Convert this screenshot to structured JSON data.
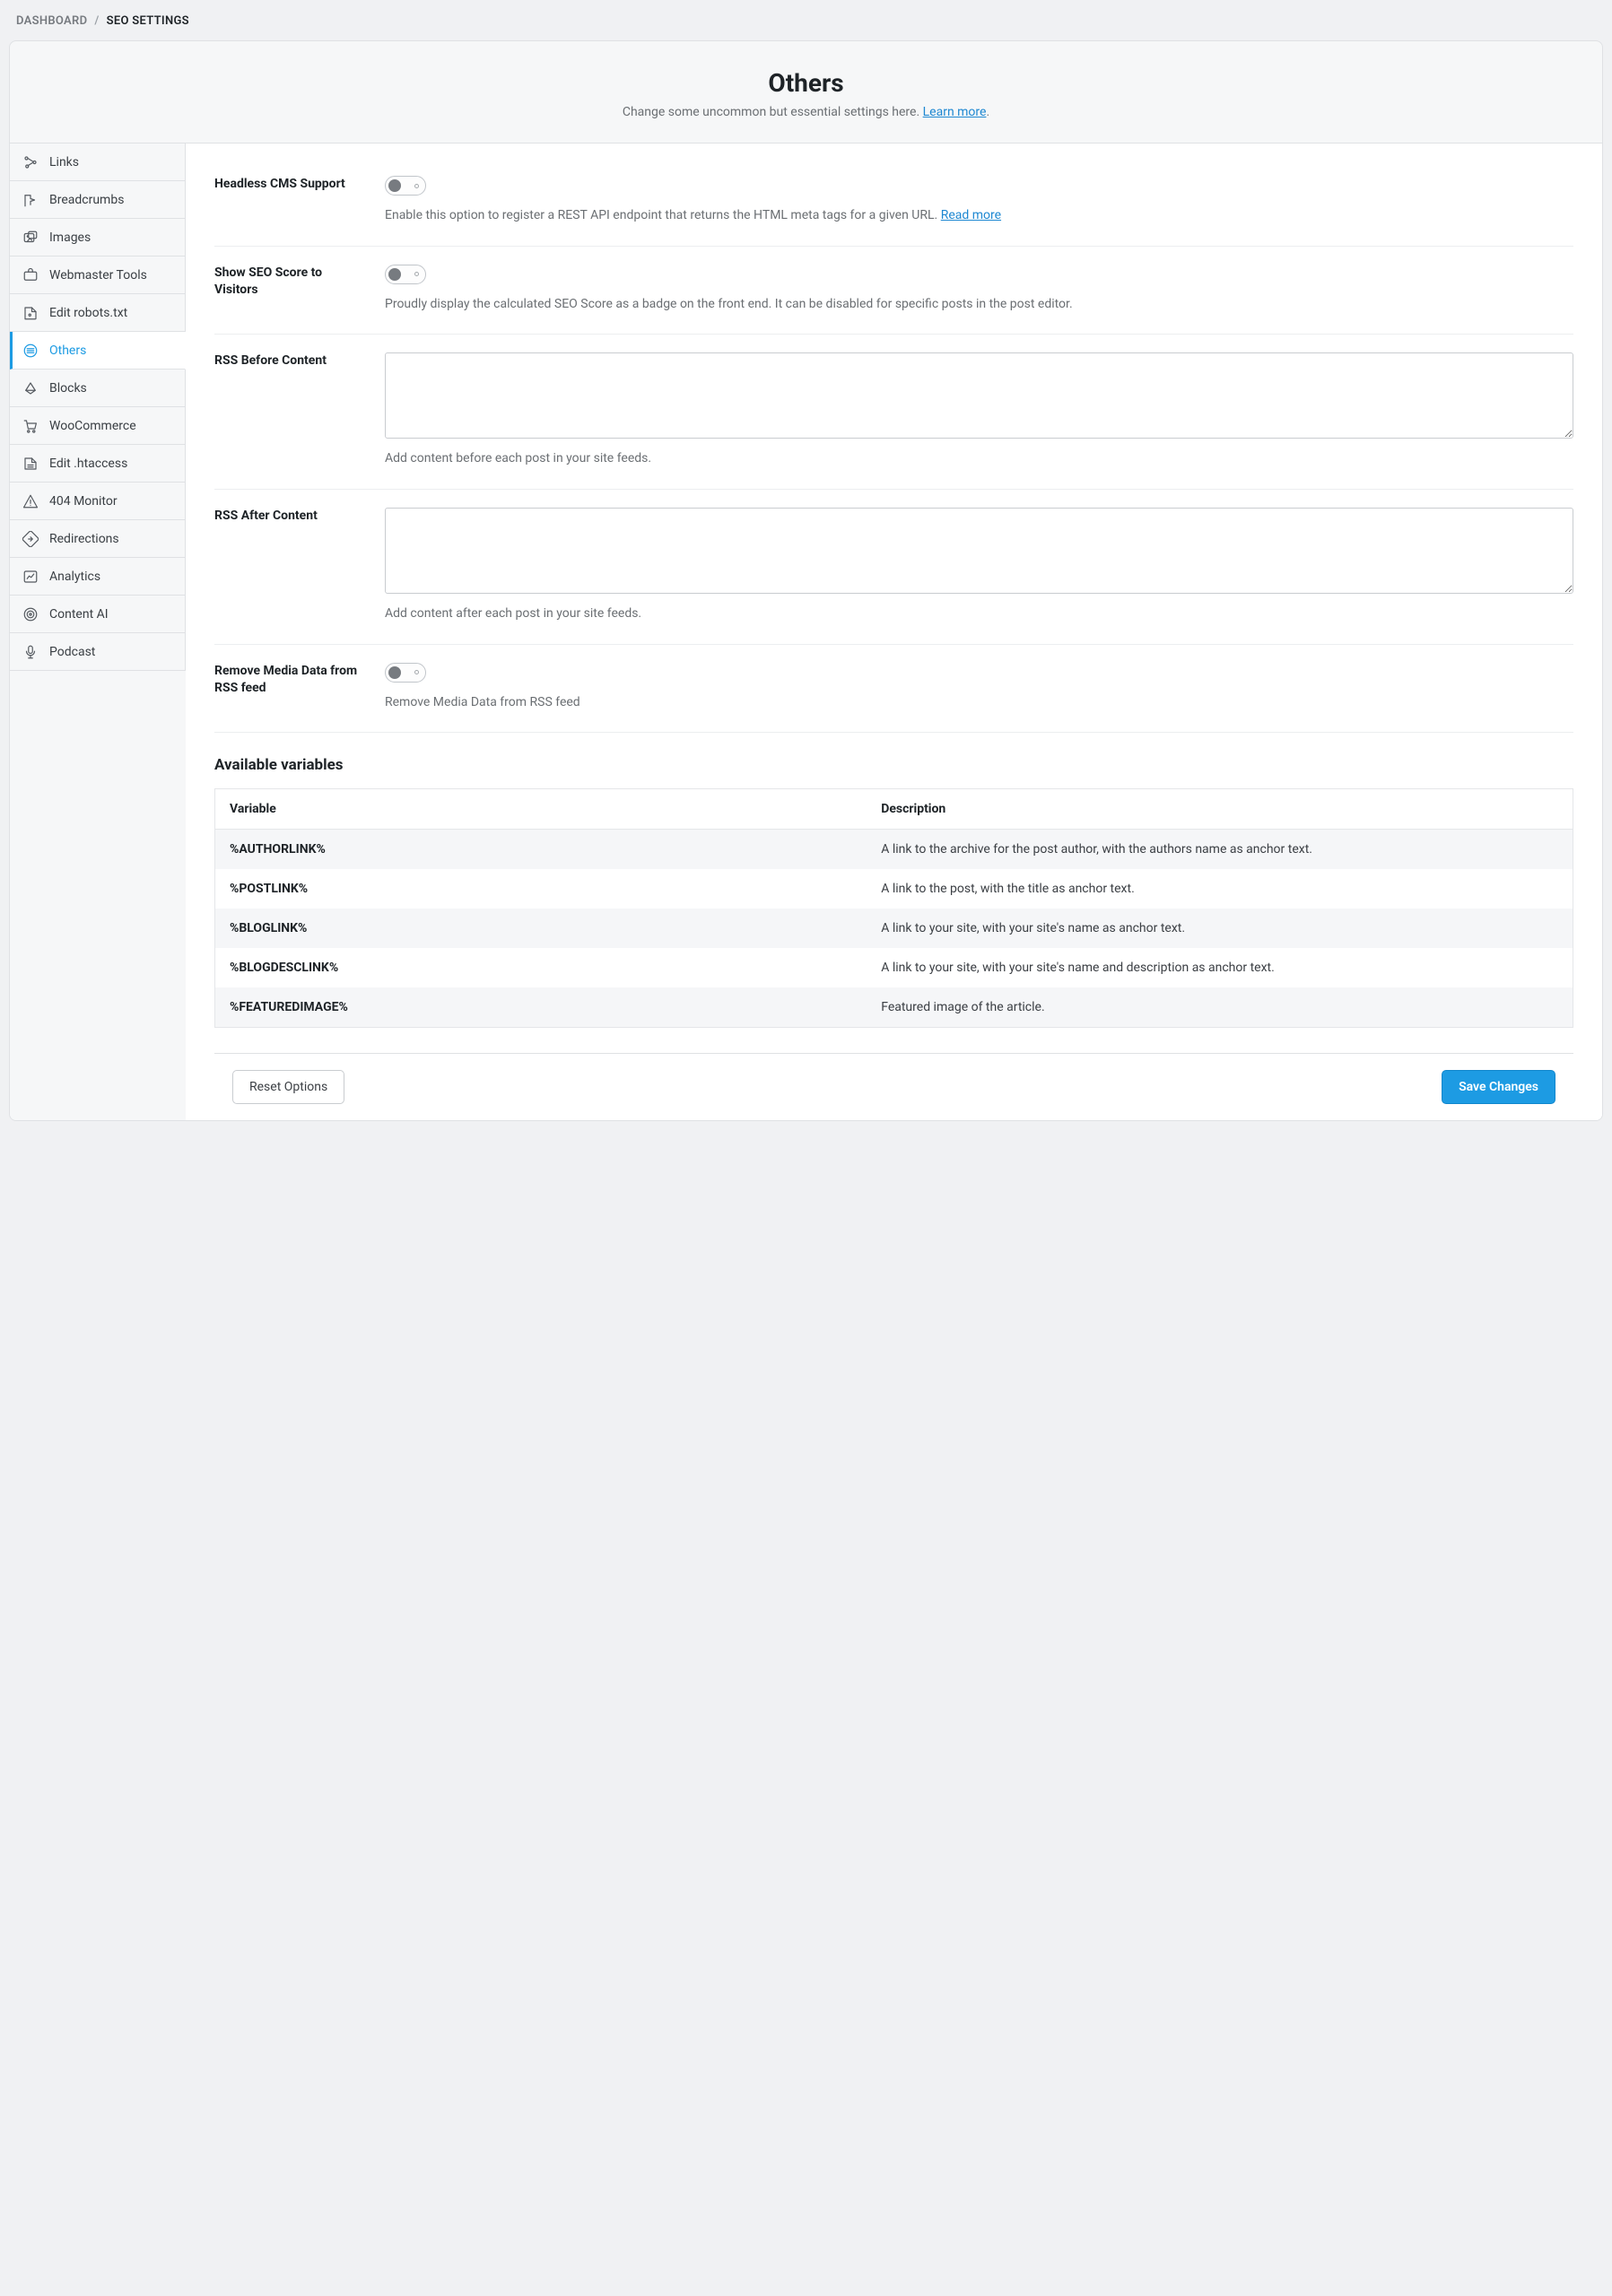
{
  "breadcrumb": {
    "root": "DASHBOARD",
    "current": "SEO SETTINGS"
  },
  "header": {
    "title": "Others",
    "subtitle": "Change some uncommon but essential settings here. ",
    "learn_more": "Learn more"
  },
  "sidebar": {
    "items": [
      {
        "key": "links",
        "label": "Links",
        "active": false
      },
      {
        "key": "breadcrumbs",
        "label": "Breadcrumbs",
        "active": false
      },
      {
        "key": "images",
        "label": "Images",
        "active": false
      },
      {
        "key": "webmaster",
        "label": "Webmaster Tools",
        "active": false
      },
      {
        "key": "robots",
        "label": "Edit robots.txt",
        "active": false
      },
      {
        "key": "others",
        "label": "Others",
        "active": true
      },
      {
        "key": "blocks",
        "label": "Blocks",
        "active": false
      },
      {
        "key": "woo",
        "label": "WooCommerce",
        "active": false
      },
      {
        "key": "htaccess",
        "label": "Edit .htaccess",
        "active": false
      },
      {
        "key": "404",
        "label": "404 Monitor",
        "active": false
      },
      {
        "key": "redirections",
        "label": "Redirections",
        "active": false
      },
      {
        "key": "analytics",
        "label": "Analytics",
        "active": false
      },
      {
        "key": "contentai",
        "label": "Content AI",
        "active": false
      },
      {
        "key": "podcast",
        "label": "Podcast",
        "active": false
      }
    ]
  },
  "settings": {
    "headless": {
      "label": "Headless CMS Support",
      "value": false,
      "desc": "Enable this option to register a REST API endpoint that returns the HTML meta tags for a given URL. ",
      "link": "Read more"
    },
    "seo_score": {
      "label": "Show SEO Score to Visitors",
      "value": false,
      "desc": "Proudly display the calculated SEO Score as a badge on the front end. It can be disabled for specific posts in the post editor."
    },
    "rss_before": {
      "label": "RSS Before Content",
      "value": "",
      "desc": "Add content before each post in your site feeds."
    },
    "rss_after": {
      "label": "RSS After Content",
      "value": "",
      "desc": "Add content after each post in your site feeds."
    },
    "remove_media": {
      "label": "Remove Media Data from RSS feed",
      "value": false,
      "desc": "Remove Media Data from RSS feed"
    }
  },
  "variables": {
    "title": "Available variables",
    "columns": {
      "variable": "Variable",
      "description": "Description"
    },
    "rows": [
      {
        "variable": "%AUTHORLINK%",
        "description": "A link to the archive for the post author, with the authors name as anchor text."
      },
      {
        "variable": "%POSTLINK%",
        "description": "A link to the post, with the title as anchor text."
      },
      {
        "variable": "%BLOGLINK%",
        "description": "A link to your site, with your site's name as anchor text."
      },
      {
        "variable": "%BLOGDESCLINK%",
        "description": "A link to your site, with your site's name and description as anchor text."
      },
      {
        "variable": "%FEATUREDIMAGE%",
        "description": "Featured image of the article."
      }
    ]
  },
  "footer": {
    "reset": "Reset Options",
    "save": "Save Changes"
  }
}
